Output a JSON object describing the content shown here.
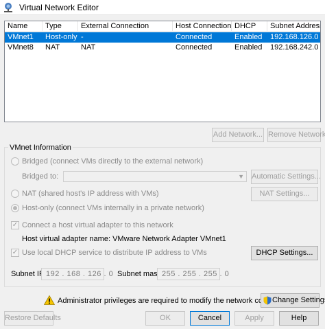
{
  "window": {
    "title": "Virtual Network Editor",
    "icon": "vmware-network-icon"
  },
  "network_list": {
    "columns": [
      "Name",
      "Type",
      "External Connection",
      "Host Connection",
      "DHCP",
      "Subnet Address"
    ],
    "rows": [
      {
        "name": "VMnet1",
        "type": "Host-only",
        "external": "-",
        "host": "Connected",
        "dhcp": "Enabled",
        "subnet": "192.168.126.0",
        "selected": true
      },
      {
        "name": "VMnet8",
        "type": "NAT",
        "external": "NAT",
        "host": "Connected",
        "dhcp": "Enabled",
        "subnet": "192.168.242.0",
        "selected": false
      }
    ]
  },
  "list_buttons": {
    "add_network": "Add Network...",
    "remove_network": "Remove Network"
  },
  "vmnet_info": {
    "title": "VMnet Information",
    "bridged_label": "Bridged (connect VMs directly to the external network)",
    "bridged_to_label": "Bridged to:",
    "bridged_to_value": "",
    "automatic_settings": "Automatic Settings...",
    "nat_label": "NAT (shared host's IP address with VMs)",
    "nat_settings": "NAT Settings...",
    "host_only_label": "Host-only (connect VMs internally in a private network)",
    "selected_mode": "host-only",
    "connect_adapter_label": "Connect a host virtual adapter to this network",
    "connect_adapter_checked": true,
    "adapter_name_label": "Host virtual adapter name: VMware Network Adapter VMnet1",
    "use_dhcp_label": "Use local DHCP service to distribute IP address to VMs",
    "use_dhcp_checked": true,
    "dhcp_settings": "DHCP Settings...",
    "subnet_ip_label": "Subnet IP:",
    "subnet_ip_value": "192 . 168 . 126 .  0",
    "subnet_mask_label": "Subnet mask:",
    "subnet_mask_value": "255 . 255 . 255 .  0"
  },
  "admin": {
    "message": "Administrator privileges are required to modify the network configuration.",
    "change_settings": "Change Settings"
  },
  "footer": {
    "restore_defaults": "Restore Defaults",
    "ok": "OK",
    "cancel": "Cancel",
    "apply": "Apply",
    "help": "Help"
  },
  "colors": {
    "selection": "#0078d7",
    "disabled_text": "#a0a0a0",
    "warning": "#f5c400"
  }
}
